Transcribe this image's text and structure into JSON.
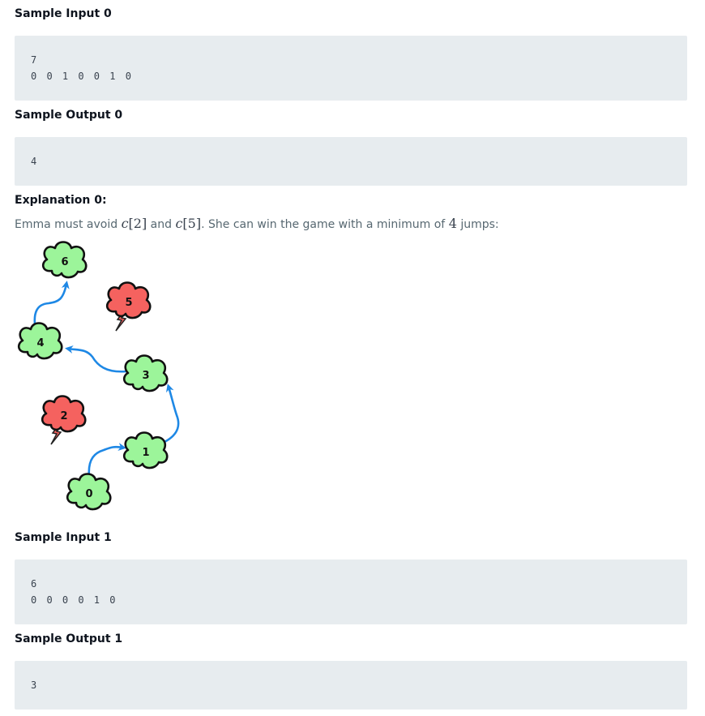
{
  "sample_input_0": {
    "heading": "Sample Input 0",
    "lines": [
      "7",
      "0 0 1 0 0 1 0"
    ]
  },
  "sample_output_0": {
    "heading": "Sample Output 0",
    "lines": [
      "4"
    ]
  },
  "explanation_0": {
    "heading": "Explanation 0:",
    "text_before": "Emma must avoid ",
    "math_1_var": "c",
    "math_1_idx": "[2]",
    "text_mid": " and ",
    "math_2_var": "c",
    "math_2_idx": "[5]",
    "text_mid2": ". She can win the game with a minimum of ",
    "math_3": "4",
    "text_after": " jumps:"
  },
  "diagram": {
    "safe_color": "#9cf59a",
    "thunder_color": "#f5625f",
    "arrow_color": "#1e88e5",
    "clouds": [
      {
        "label": "0",
        "type": "safe"
      },
      {
        "label": "1",
        "type": "safe"
      },
      {
        "label": "2",
        "type": "thunder"
      },
      {
        "label": "3",
        "type": "safe"
      },
      {
        "label": "4",
        "type": "safe"
      },
      {
        "label": "5",
        "type": "thunder"
      },
      {
        "label": "6",
        "type": "safe"
      }
    ]
  },
  "sample_input_1": {
    "heading": "Sample Input 1",
    "lines": [
      "6",
      "0 0 0 0 1 0"
    ]
  },
  "sample_output_1": {
    "heading": "Sample Output 1",
    "lines": [
      "3"
    ]
  }
}
